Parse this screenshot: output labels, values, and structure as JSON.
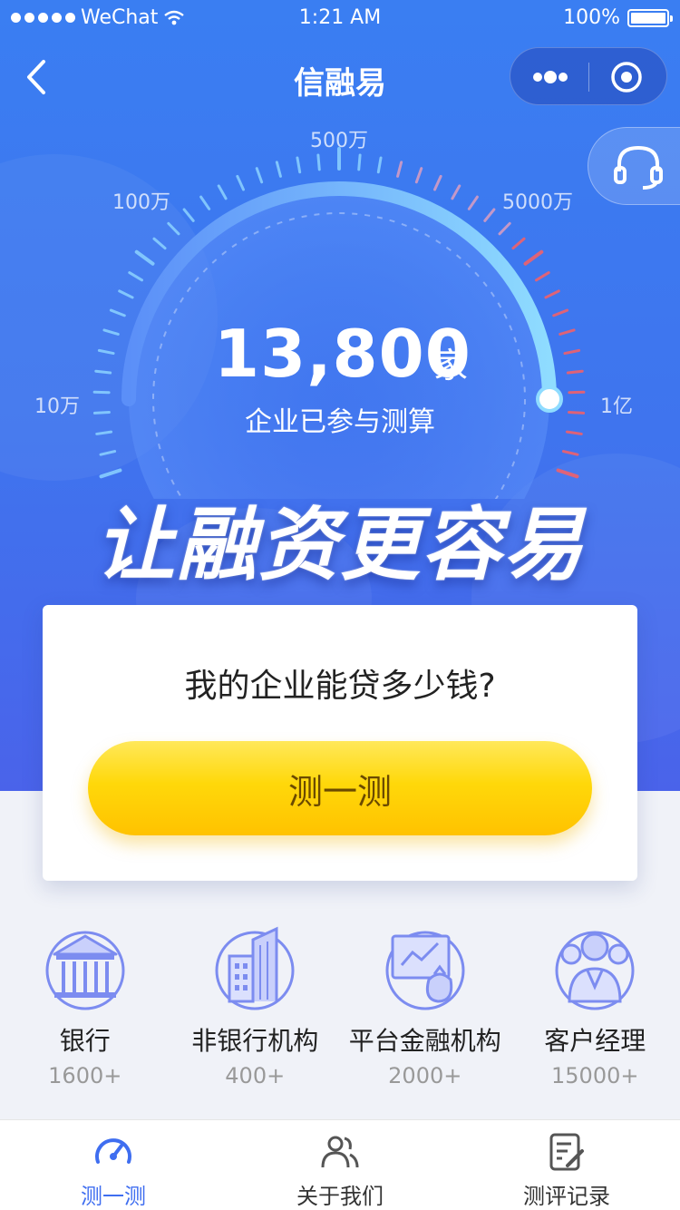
{
  "status_bar": {
    "carrier": "WeChat",
    "time": "1:21 AM",
    "battery": "100%"
  },
  "navbar": {
    "title": "信融易"
  },
  "gauge": {
    "labels": [
      "10万",
      "100万",
      "500万",
      "5000万",
      "1亿"
    ],
    "count": "13,800",
    "unit": "家",
    "subtitle": "企业已参与测算"
  },
  "slogan": "让融资更容易",
  "card": {
    "question": "我的企业能贷多少钱?",
    "button_label": "测一测"
  },
  "categories": [
    {
      "name": "银行",
      "count": "1600+",
      "icon": "bank-icon"
    },
    {
      "name": "非银行机构",
      "count": "400+",
      "icon": "building-icon"
    },
    {
      "name": "平台金融机构",
      "count": "2000+",
      "icon": "platform-icon"
    },
    {
      "name": "客户经理",
      "count": "15000+",
      "icon": "manager-icon"
    }
  ],
  "tabbar": [
    {
      "label": "测一测",
      "icon": "speedometer-icon",
      "active": true
    },
    {
      "label": "关于我们",
      "icon": "people-icon",
      "active": false
    },
    {
      "label": "测评记录",
      "icon": "record-icon",
      "active": false
    }
  ],
  "colors": {
    "primary": "#3f6ef0",
    "hero_top": "#3a7ef2",
    "button": "#ffd80a",
    "accent_red": "#f0606a"
  }
}
